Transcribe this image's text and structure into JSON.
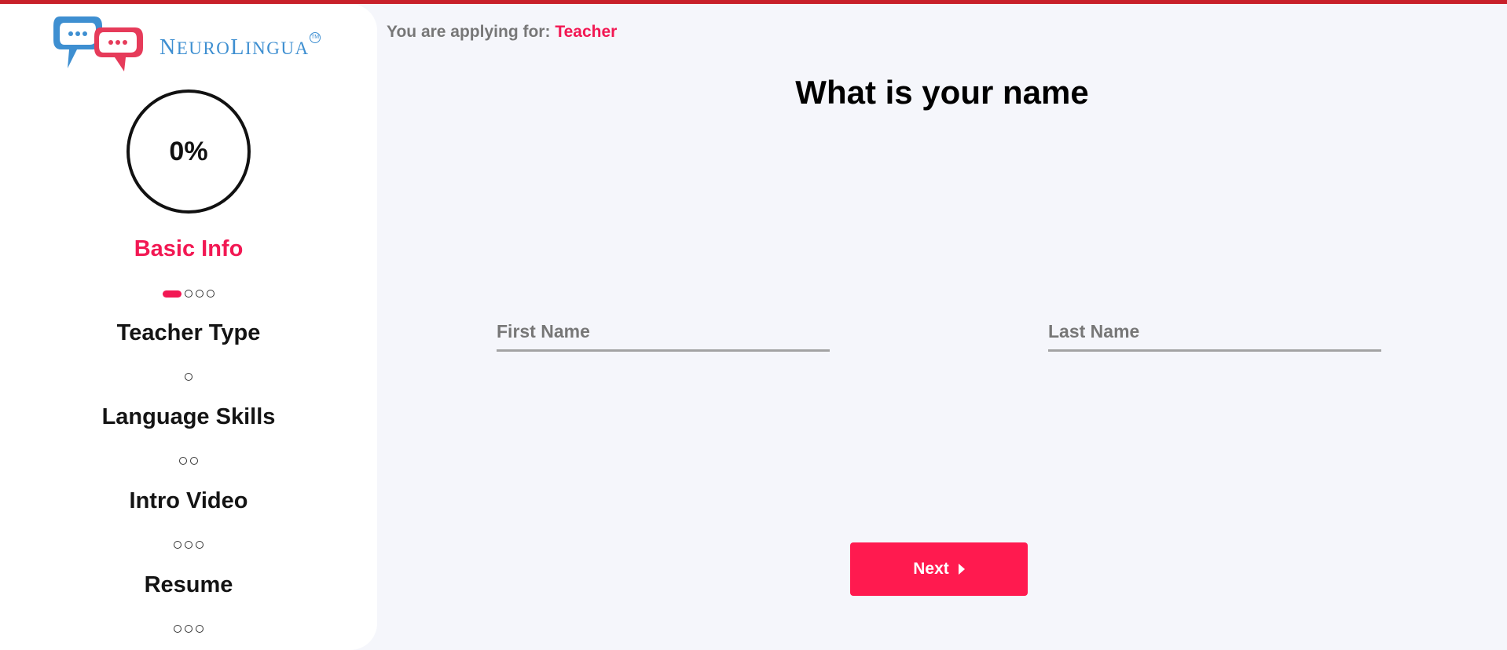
{
  "brand": {
    "logo_text": "NeuroLingua",
    "logo_text_n": "N",
    "logo_text_rest1": "EURO",
    "logo_text_l": "L",
    "logo_text_rest2": "INGUA",
    "trademark": "TM",
    "accent_color": "#f21853",
    "logo_blue": "#3e8fd1",
    "logo_red": "#e63b5a"
  },
  "progress": {
    "value": 0,
    "label": "0%"
  },
  "steps": [
    {
      "label": "Basic Info",
      "active": true,
      "sub_steps": 4,
      "current_sub_step": 1
    },
    {
      "label": "Teacher Type",
      "active": false,
      "sub_steps": 1
    },
    {
      "label": "Language Skills",
      "active": false,
      "sub_steps": 2
    },
    {
      "label": "Intro Video",
      "active": false,
      "sub_steps": 3
    },
    {
      "label": "Resume",
      "active": false,
      "sub_steps": 3
    }
  ],
  "header": {
    "applying_prefix": "You are applying for:",
    "applying_role": "Teacher"
  },
  "form": {
    "question": "What is your name",
    "first_name": {
      "value": "",
      "placeholder": "First Name"
    },
    "last_name": {
      "value": "",
      "placeholder": "Last Name"
    },
    "next_label": "Next"
  },
  "icons": {
    "next": "caret-right-icon",
    "logo": "speech-bubbles-icon"
  }
}
